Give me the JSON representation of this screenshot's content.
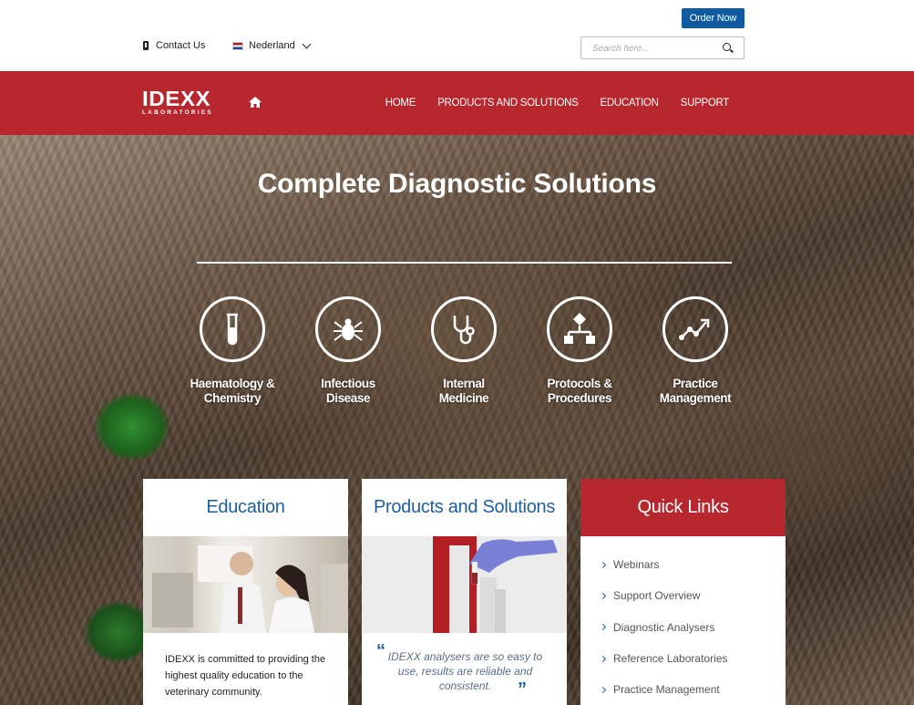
{
  "utility": {
    "order_now": "Order Now",
    "contact_label": "Contact Us",
    "country_label": "Nederland",
    "search_placeholder": "Search here..."
  },
  "nav": {
    "logo_word": "IDEXX",
    "logo_sub": "LABORATORIES",
    "links": [
      "HOME",
      "PRODUCTS AND SOLUTIONS",
      "EDUCATION",
      "SUPPORT"
    ]
  },
  "hero": {
    "title": "Complete Diagnostic Solutions",
    "categories": [
      {
        "line1": "Haematology &",
        "line2": "Chemistry",
        "icon": "test-tube-icon"
      },
      {
        "line1": "Infectious",
        "line2": "Disease",
        "icon": "tick-icon"
      },
      {
        "line1": "Internal",
        "line2": "Medicine",
        "icon": "stethoscope-icon"
      },
      {
        "line1": "Protocols &",
        "line2": "Procedures",
        "icon": "flowchart-icon"
      },
      {
        "line1": "Practice",
        "line2": "Management",
        "icon": "trend-chart-icon"
      }
    ]
  },
  "cards": {
    "education": {
      "title": "Education",
      "text": "IDEXX is committed to providing the highest quality education to the veterinary community."
    },
    "products": {
      "title": "Products and Solutions",
      "quote": "IDEXX analysers are so easy to use, results are reliable and consistent."
    },
    "quick_links": {
      "title": "Quick Links",
      "items": [
        "Webinars",
        "Support Overview",
        "Diagnostic Analysers",
        "Reference Laboratories",
        "Practice Management"
      ]
    }
  },
  "colors": {
    "brand_red": "#b6272e",
    "brand_blue": "#0f5aa0",
    "link_blue": "#1d5f9e"
  }
}
